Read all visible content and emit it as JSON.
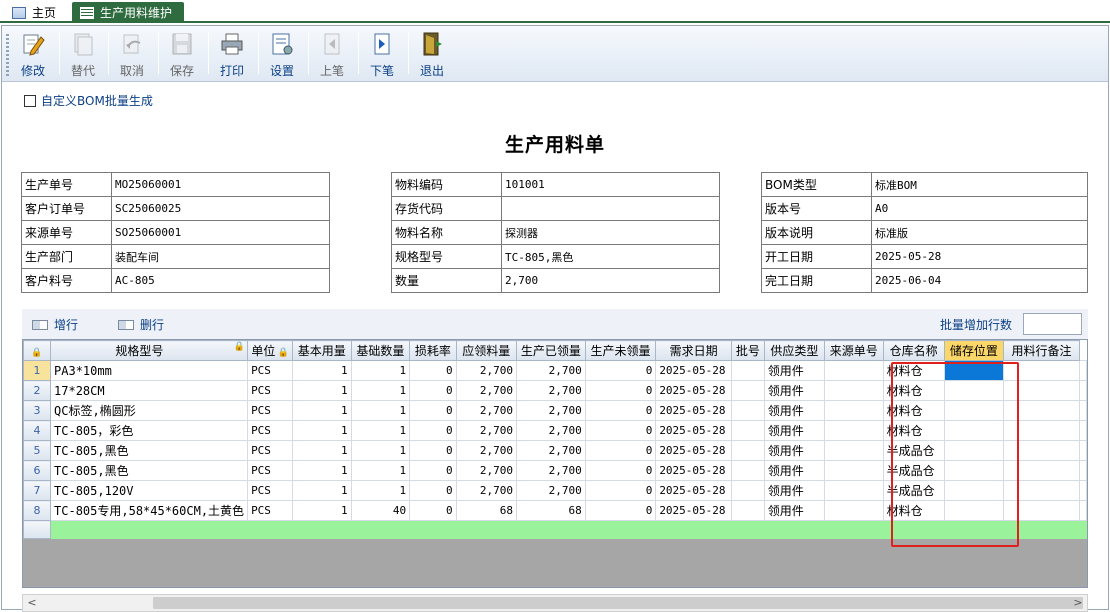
{
  "tabs": {
    "home": "主页",
    "active": "生产用料维护"
  },
  "toolbar": {
    "buttons": [
      {
        "label": "修改",
        "icon": "edit-icon",
        "enabled": true
      },
      {
        "label": "替代",
        "icon": "replace-icon",
        "enabled": false
      },
      {
        "label": "取消",
        "icon": "undo-icon",
        "enabled": false
      },
      {
        "label": "保存",
        "icon": "save-icon",
        "enabled": false
      },
      {
        "label": "打印",
        "icon": "print-icon",
        "enabled": true
      },
      {
        "label": "设置",
        "icon": "settings-icon",
        "enabled": true
      },
      {
        "label": "上笔",
        "icon": "prev-record-icon",
        "enabled": false
      },
      {
        "label": "下笔",
        "icon": "next-record-icon",
        "enabled": true
      },
      {
        "label": "退出",
        "icon": "exit-icon",
        "enabled": true
      }
    ]
  },
  "bom_checkbox": {
    "label": "自定义BOM批量生成",
    "checked": false
  },
  "form_title": "生产用料单",
  "info": {
    "left": [
      {
        "key": "生产单号",
        "value": "MO25060001"
      },
      {
        "key": "客户订单号",
        "value": "SC25060025"
      },
      {
        "key": "来源单号",
        "value": "SO25060001"
      },
      {
        "key": "生产部门",
        "value": "装配车间"
      },
      {
        "key": "客户料号",
        "value": "AC-805"
      }
    ],
    "middle": [
      {
        "key": "物料编码",
        "value": "101001"
      },
      {
        "key": "存货代码",
        "value": ""
      },
      {
        "key": "物料名称",
        "value": "探测器"
      },
      {
        "key": "规格型号",
        "value": "TC-805,黑色"
      },
      {
        "key": "数量",
        "value": "2,700"
      }
    ],
    "right": [
      {
        "key": "BOM类型",
        "value": "标准BOM"
      },
      {
        "key": "版本号",
        "value": "A0"
      },
      {
        "key": "版本说明",
        "value": "标准版"
      },
      {
        "key": "开工日期",
        "value": "2025-05-28"
      },
      {
        "key": "完工日期",
        "value": "2025-06-04"
      }
    ]
  },
  "grid_toolbar": {
    "add_row": "增行",
    "delete_row": "删行",
    "batch_label": "批量增加行数",
    "batch_value": ""
  },
  "grid": {
    "columns": [
      "规格型号",
      "单位",
      "基本用量",
      "基础数量",
      "损耗率",
      "应领料量",
      "生产已领量",
      "生产未领量",
      "需求日期",
      "批号",
      "供应类型",
      "来源单号",
      "仓库名称",
      "储存位置",
      "用料行备注"
    ],
    "rows": [
      [
        "PA3*10mm",
        "PCS",
        "1",
        "1",
        "0",
        "2,700",
        "2,700",
        "0",
        "2025-05-28",
        "",
        "领用件",
        "",
        "材料仓",
        "",
        ""
      ],
      [
        "17*28CM",
        "PCS",
        "1",
        "1",
        "0",
        "2,700",
        "2,700",
        "0",
        "2025-05-28",
        "",
        "领用件",
        "",
        "材料仓",
        "",
        ""
      ],
      [
        "QC标签,椭圆形",
        "PCS",
        "1",
        "1",
        "0",
        "2,700",
        "2,700",
        "0",
        "2025-05-28",
        "",
        "领用件",
        "",
        "材料仓",
        "",
        ""
      ],
      [
        "TC-805，彩色",
        "PCS",
        "1",
        "1",
        "0",
        "2,700",
        "2,700",
        "0",
        "2025-05-28",
        "",
        "领用件",
        "",
        "材料仓",
        "",
        ""
      ],
      [
        "TC-805,黑色",
        "PCS",
        "1",
        "1",
        "0",
        "2,700",
        "2,700",
        "0",
        "2025-05-28",
        "",
        "领用件",
        "",
        "半成品仓",
        "",
        ""
      ],
      [
        "TC-805,黑色",
        "PCS",
        "1",
        "1",
        "0",
        "2,700",
        "2,700",
        "0",
        "2025-05-28",
        "",
        "领用件",
        "",
        "半成品仓",
        "",
        ""
      ],
      [
        "TC-805,120V",
        "PCS",
        "1",
        "1",
        "0",
        "2,700",
        "2,700",
        "0",
        "2025-05-28",
        "",
        "领用件",
        "",
        "半成品仓",
        "",
        ""
      ],
      [
        "TC-805专用,58*45*60CM,土黄色",
        "PCS",
        "1",
        "40",
        "0",
        "68",
        "68",
        "0",
        "2025-05-28",
        "",
        "领用件",
        "",
        "材料仓",
        "",
        ""
      ]
    ],
    "row_numbers": [
      "1",
      "2",
      "3",
      "4",
      "5",
      "6",
      "7",
      "8"
    ],
    "highlight_column": "储存位置",
    "selected_row": 1
  },
  "colors": {
    "tab_active": "#2e6b3f",
    "header_highlight": "#fbd668",
    "cell_selected": "#0b78d8",
    "new_row": "#9af29a",
    "annotation_box": "#e0201c",
    "label_blue": "#0b3f86"
  }
}
